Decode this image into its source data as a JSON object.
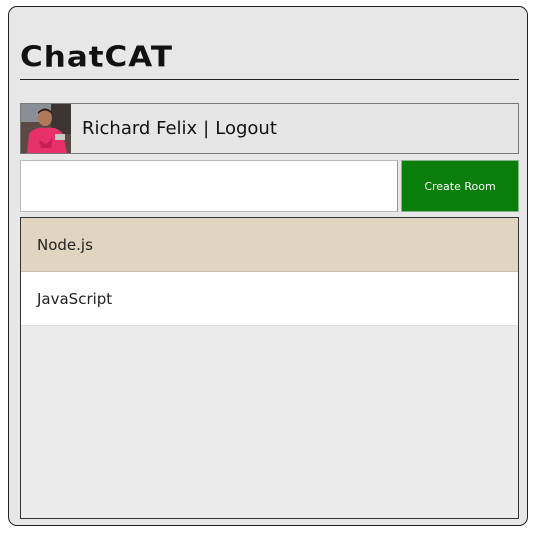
{
  "app": {
    "title": "ChatCAT"
  },
  "user": {
    "name": "Richard Felix",
    "separator": "|",
    "logout_label": "Logout",
    "avatar_icon": "user-avatar-photo"
  },
  "create_room": {
    "input_value": "",
    "input_placeholder": "",
    "button_label": "Create Room",
    "button_color": "#0a7d0a"
  },
  "rooms": [
    {
      "label": "Node.js",
      "active": true
    },
    {
      "label": "JavaScript",
      "active": false
    }
  ],
  "colors": {
    "active_room_bg": "#e1d5c2",
    "panel_bg": "#e7e7e7"
  }
}
